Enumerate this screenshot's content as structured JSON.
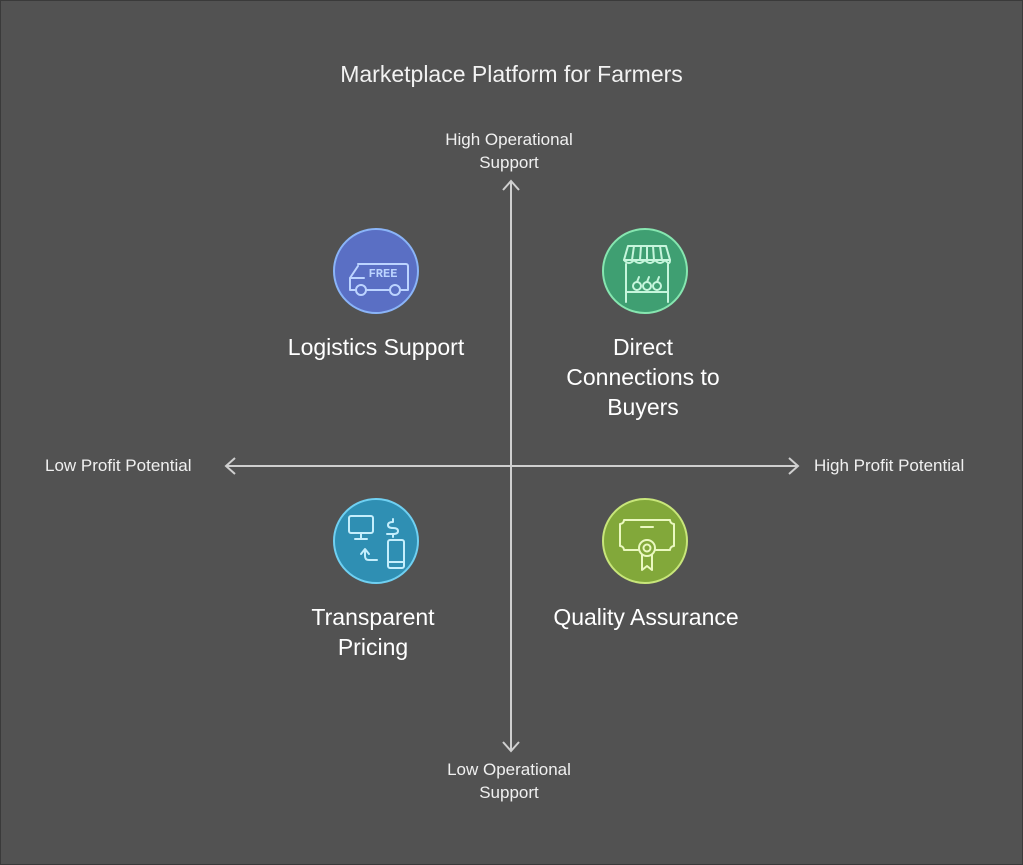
{
  "title": "Marketplace Platform for Farmers",
  "axes": {
    "y_top": "High Operational Support",
    "y_top_lines": [
      "High Operational",
      "Support"
    ],
    "y_bottom": "Low Operational Support",
    "y_bottom_lines": [
      "Low Operational",
      "Support"
    ],
    "x_left": "Low Profit Potential",
    "x_right": "High Profit Potential"
  },
  "quadrants": [
    {
      "position": "top-left",
      "label": "Logistics Support",
      "icon": "free-delivery-truck-icon",
      "color": "#8ab4f8",
      "fill": "#5a6fc4"
    },
    {
      "position": "top-right",
      "label": "Direct Connections to Buyers",
      "label_lines": [
        "Direct",
        "Connections to",
        "Buyers"
      ],
      "icon": "market-stall-icon",
      "color": "#86e6b0",
      "fill": "#3f9f72"
    },
    {
      "position": "bottom-left",
      "label": "Transparent Pricing",
      "label_lines": [
        "Transparent",
        "Pricing"
      ],
      "icon": "price-exchange-icon",
      "color": "#6fd0f2",
      "fill": "#2f8fb3"
    },
    {
      "position": "bottom-right",
      "label": "Quality Assurance",
      "icon": "certificate-icon",
      "color": "#c8e67a",
      "fill": "#82a83a"
    }
  ]
}
